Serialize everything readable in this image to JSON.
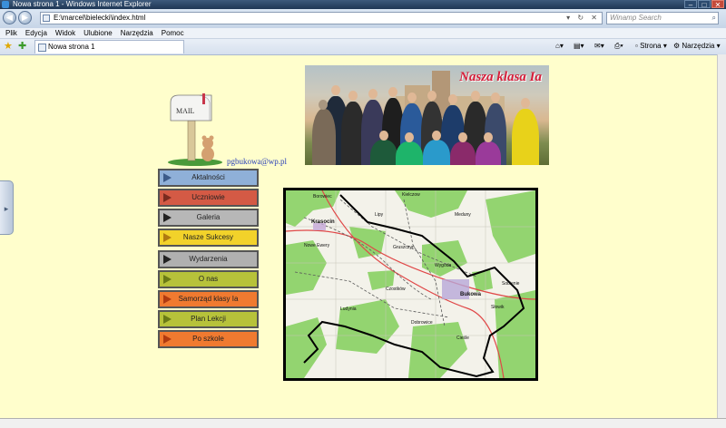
{
  "window": {
    "title": "Nowa strona 1 - Windows Internet Explorer",
    "min": "–",
    "max": "□",
    "close": "✕"
  },
  "address": {
    "url": "E:\\marcel\\bielecki\\index.html",
    "search_placeholder": "Winamp Search"
  },
  "menubar": {
    "items": [
      "Plik",
      "Edycja",
      "Widok",
      "Ulubione",
      "Narzędzia",
      "Pomoc"
    ]
  },
  "tab": {
    "label": "Nowa strona 1"
  },
  "commandbar": {
    "page": "Strona",
    "tools": "Narzędzia"
  },
  "page": {
    "email": "pgbukowa@wp.pl",
    "mailbox_text": "MAIL",
    "photo_title": "Nasza klasa Ia",
    "menu": [
      {
        "label": "Aktalności",
        "bg": "#8fb0d8",
        "arrow": "#3c5b8a"
      },
      {
        "label": "Uczniowie",
        "bg": "#d45a45",
        "arrow": "#7a2a1e"
      },
      {
        "label": "Galeria",
        "bg": "#b7b7b7",
        "arrow": "#222222"
      },
      {
        "label": "Nasze Sukcesy",
        "bg": "#f2d22a",
        "arrow": "#b07a10"
      },
      {
        "label": "Wydarzenia",
        "bg": "#b0b0b0",
        "arrow": "#222222"
      },
      {
        "label": "O nas",
        "bg": "#b7c23a",
        "arrow": "#6a7a16"
      },
      {
        "label": "Samorząd klasy Ia",
        "bg": "#f07a30",
        "arrow": "#b03a10"
      },
      {
        "label": "Plan Lekcji",
        "bg": "#b7c23a",
        "arrow": "#6a7a16"
      },
      {
        "label": "Po szkole",
        "bg": "#f07a30",
        "arrow": "#b03a10"
      }
    ],
    "map_labels": [
      "Borowiec",
      "Kielczow",
      "Meduny",
      "Krasocin",
      "Lipy",
      "Nowe Ewery",
      "Gruszczyn",
      "Wygoda",
      "Sobienie",
      "Czostków",
      "Ludynia",
      "Dobrowice",
      "Bukowa",
      "Cieśle",
      "Słowik"
    ]
  },
  "colors": {
    "page_bg": "#fffecc",
    "email_link": "#2a40b8",
    "photo_title": "#d61e3a"
  }
}
